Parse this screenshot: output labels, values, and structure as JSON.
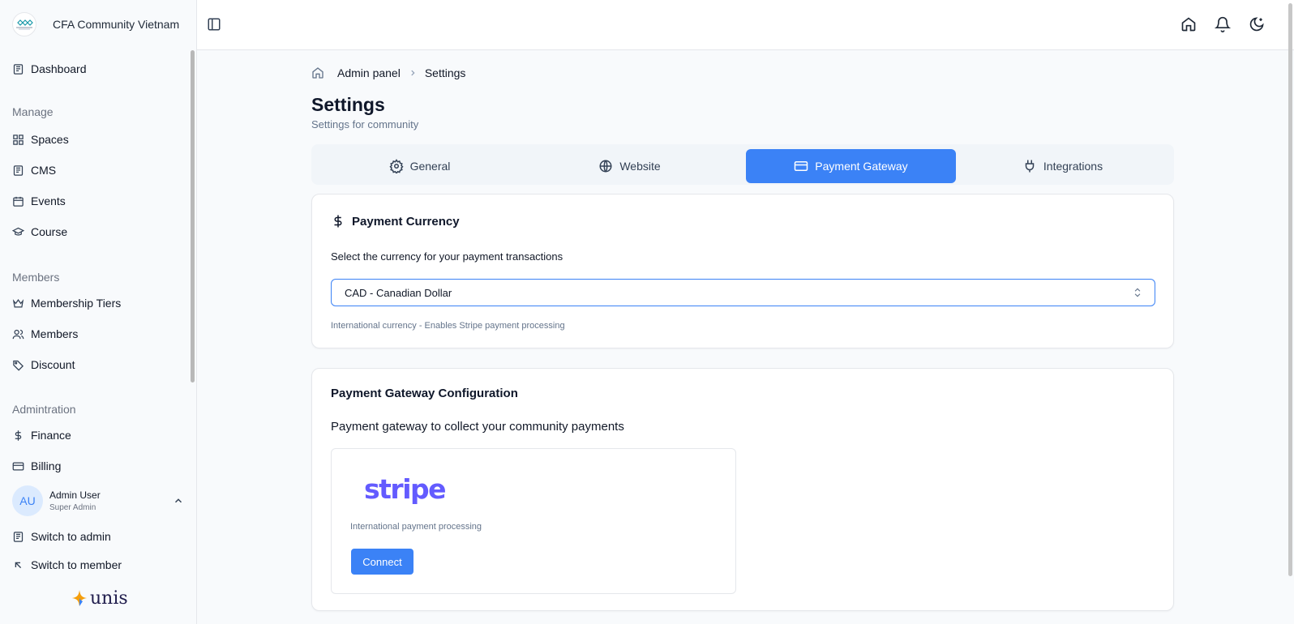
{
  "brand": {
    "name": "CFA Community Vietnam"
  },
  "sidebar": {
    "top": {
      "label": "Dashboard",
      "icon": "dashboard-icon"
    },
    "groups": [
      {
        "label": "Manage",
        "items": [
          {
            "label": "Spaces",
            "icon": "grid-icon"
          },
          {
            "label": "CMS",
            "icon": "newspaper-icon"
          },
          {
            "label": "Events",
            "icon": "calendar-icon"
          },
          {
            "label": "Course",
            "icon": "graduation-cap-icon"
          }
        ]
      },
      {
        "label": "Members",
        "items": [
          {
            "label": "Membership Tiers",
            "icon": "crown-icon"
          },
          {
            "label": "Members",
            "icon": "users-icon"
          },
          {
            "label": "Discount",
            "icon": "tag-icon"
          }
        ]
      },
      {
        "label": "Admintration",
        "items": [
          {
            "label": "Finance",
            "icon": "dollar-icon"
          },
          {
            "label": "Billing",
            "icon": "credit-card-icon"
          }
        ]
      }
    ],
    "user": {
      "initials": "AU",
      "name": "Admin User",
      "role": "Super Admin"
    },
    "switch_admin": "Switch to admin",
    "switch_member": "Switch to member",
    "footer_logo": "unis"
  },
  "topbar": {
    "icons": [
      "home-icon",
      "bell-icon",
      "moon-icon"
    ]
  },
  "breadcrumb": {
    "parent": "Admin panel",
    "current": "Settings"
  },
  "page": {
    "title": "Settings",
    "subtitle": "Settings for community"
  },
  "tabs": [
    {
      "label": "General",
      "icon": "gear-icon",
      "active": false
    },
    {
      "label": "Website",
      "icon": "globe-icon",
      "active": false
    },
    {
      "label": "Payment Gateway",
      "icon": "credit-card-icon",
      "active": true
    },
    {
      "label": "Integrations",
      "icon": "plug-icon",
      "active": false
    }
  ],
  "currency": {
    "heading": "Payment Currency",
    "label": "Select the currency for your payment transactions",
    "selected": "CAD - Canadian Dollar",
    "hint": "International currency - Enables Stripe payment processing"
  },
  "gateway": {
    "heading": "Payment Gateway Configuration",
    "subheading": "Payment gateway to collect your community payments",
    "provider": {
      "logo_text": "stripe",
      "description": "International payment processing",
      "button": "Connect"
    }
  },
  "colors": {
    "accent": "#3b82f6",
    "stripe": "#635bff"
  }
}
